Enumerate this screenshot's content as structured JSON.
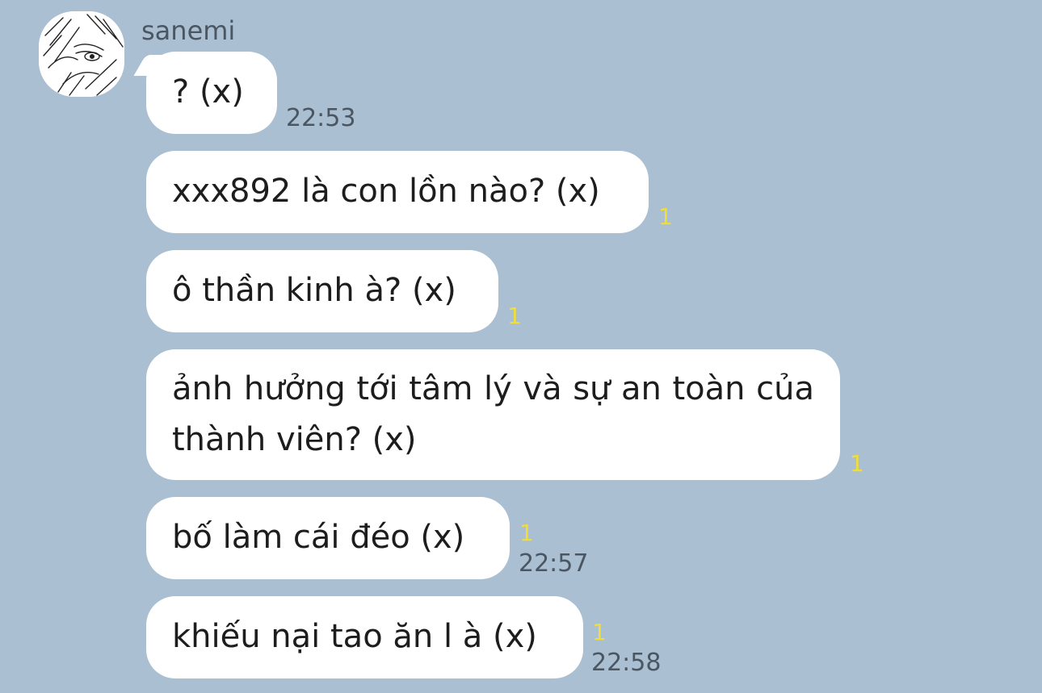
{
  "contact": {
    "name": "sanemi",
    "avatar_icon": "manga-portrait-avatar"
  },
  "messages": [
    {
      "text": "? (x)",
      "read": "",
      "time": "22:53"
    },
    {
      "text": "xxx892 là con lồn nào? (x)",
      "read": "1",
      "time": ""
    },
    {
      "text": "ô thần kinh à? (x)",
      "read": "1",
      "time": ""
    },
    {
      "text": "ảnh hưởng tới tâm lý và sự an toàn của thành viên? (x)",
      "read": "1",
      "time": ""
    },
    {
      "text": "bố làm cái đéo (x)",
      "read": "1",
      "time": "22:57"
    },
    {
      "text": "khiếu nại tao ăn l à (x)",
      "read": "1",
      "time": "22:58"
    }
  ],
  "colors": {
    "background": "#aabfd2",
    "bubble": "#ffffff",
    "read_indicator": "#f1dd3a",
    "meta_text": "#4b5663"
  }
}
